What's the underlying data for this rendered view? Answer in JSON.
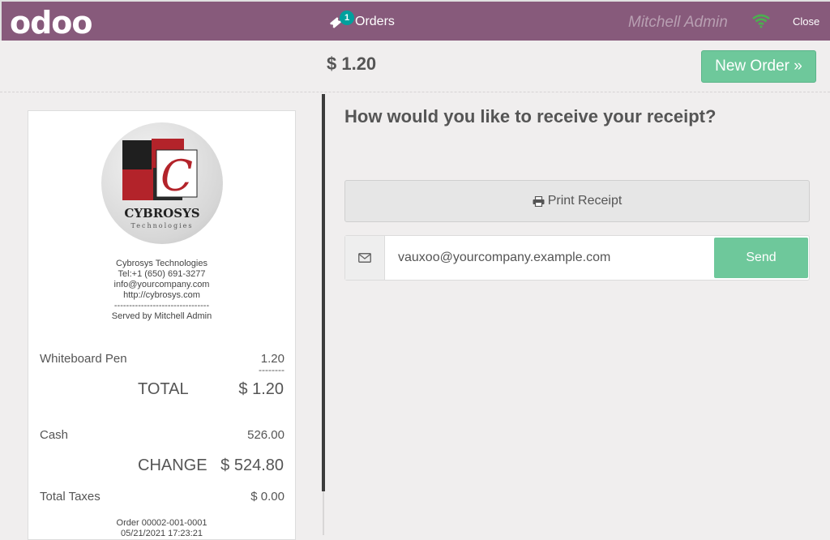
{
  "header": {
    "logo_text": "odoo",
    "orders_label": "Orders",
    "orders_count": "1",
    "cashier_name": "Mitchell Admin",
    "close_label": "Close",
    "icons": [
      "ticket-icon",
      "wifi-icon"
    ]
  },
  "top": {
    "amount": "$ 1.20",
    "new_order_label": "New Order »"
  },
  "receipt": {
    "logo_brand": "CYBROSYS",
    "logo_sub": "Technologies",
    "company_name": "Cybrosys Technologies",
    "phone": "Tel:+1 (650) 691-3277",
    "email": "info@yourcompany.com",
    "website": "http://cybrosys.com",
    "separator": "--------------------------------",
    "served_by": "Served by Mitchell Admin",
    "line_item_name": "Whiteboard Pen",
    "line_item_price": "1.20",
    "line_separator": "--------",
    "total_label": "TOTAL",
    "total_value": "$ 1.20",
    "payment_method": "Cash",
    "payment_amount": "526.00",
    "change_label": "CHANGE",
    "change_value": "$ 524.80",
    "taxes_label": "Total Taxes",
    "taxes_value": "$ 0.00",
    "order_ref": "Order 00002-001-0001",
    "order_date": "05/21/2021 17:23:21"
  },
  "panel": {
    "question": "How would you like to receive your receipt?",
    "print_label": "Print Receipt",
    "email_value": "vauxoo@yourcompany.example.com",
    "send_label": "Send"
  },
  "colors": {
    "brand": "#875a7b",
    "accent_green": "#6ec89b",
    "badge": "#00a09d",
    "wifi": "#4caf50"
  }
}
